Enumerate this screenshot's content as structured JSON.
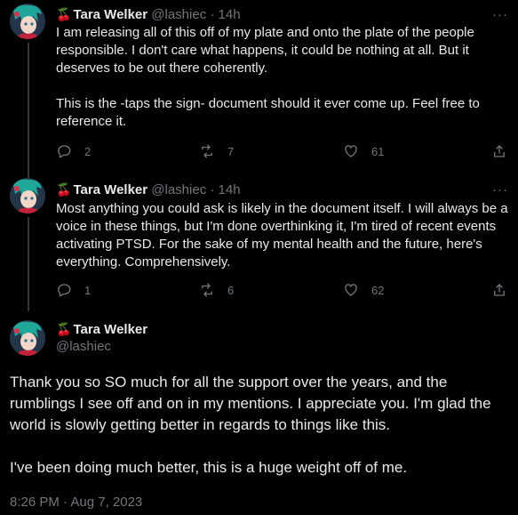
{
  "tweets": [
    {
      "emoji": "🍒",
      "name": "Tara Welker",
      "handle": "@lashiec",
      "sep": "·",
      "time": "14h",
      "text": "I am releasing all of this off of my plate and onto the plate of the people responsible. I don't care what happens, it could be nothing at all. But it deserves to be out there coherently.\n\nThis is the -taps the sign- document should it ever come up. Feel free to reference it.",
      "replies": "2",
      "retweets": "7",
      "likes": "61"
    },
    {
      "emoji": "🍒",
      "name": "Tara Welker",
      "handle": "@lashiec",
      "sep": "·",
      "time": "14h",
      "text": "Most anything you could ask is likely in the document itself. I will always be a voice in these things, but I'm done overthinking it, I'm tired of recent events activating PTSD. For the sake of my mental health and the future, here's everything. Comprehensively.",
      "replies": "1",
      "retweets": "6",
      "likes": "62"
    }
  ],
  "main": {
    "emoji": "🍒",
    "name": "Tara Welker",
    "handle": "@lashiec",
    "text": "Thank you so SO much for all the support over the years, and the rumblings I see off and on in my mentions. I appreciate you. I'm glad the world is slowly getting better in regards to things like this.\n\nI've been doing much better, this is a huge weight off of me.",
    "timestamp": "8:26 PM · Aug 7, 2023"
  },
  "more_glyph": "···",
  "colors": {
    "background": "#000000",
    "text": "#e7e9ea",
    "muted": "#71767b",
    "thread_line": "#333639"
  },
  "icons": [
    "reply-icon",
    "retweet-icon",
    "like-icon",
    "share-icon",
    "more-icon"
  ]
}
